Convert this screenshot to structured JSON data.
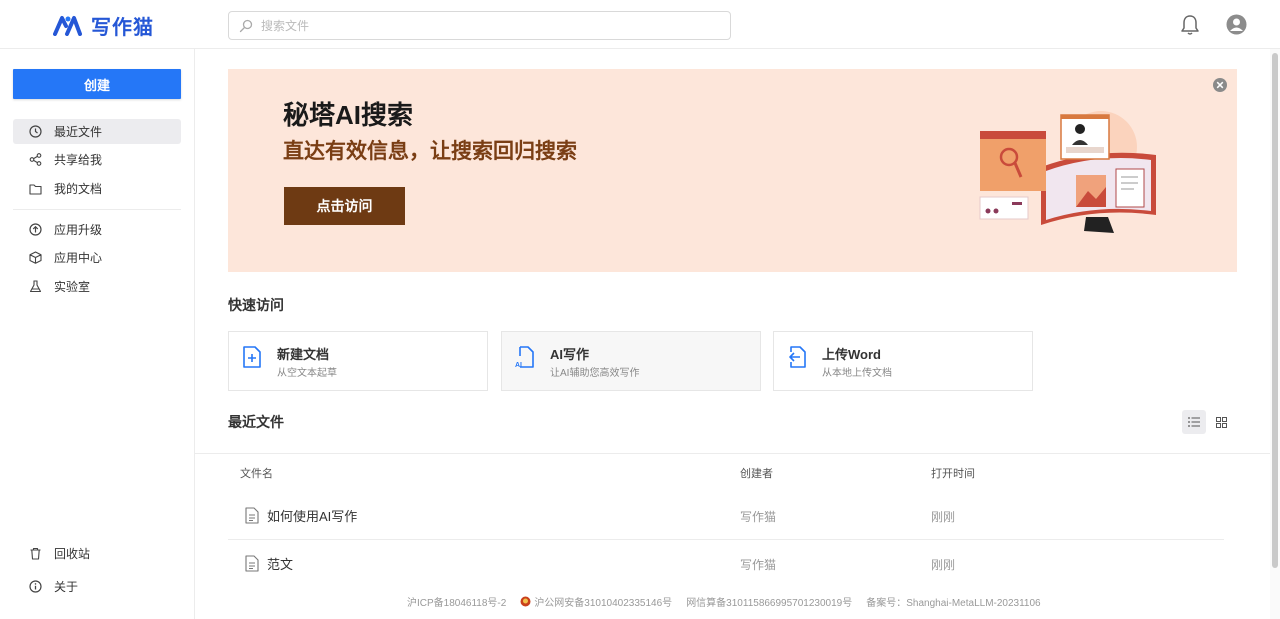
{
  "header": {
    "logo_text": "写作猫",
    "search_placeholder": "搜索文件"
  },
  "sidebar": {
    "create_label": "创建",
    "items": [
      {
        "label": "最近文件",
        "icon": "clock-icon",
        "active": true
      },
      {
        "label": "共享给我",
        "icon": "share-icon"
      },
      {
        "label": "我的文档",
        "icon": "folder-icon"
      },
      {
        "label": "应用升级",
        "icon": "upgrade-icon"
      },
      {
        "label": "应用中心",
        "icon": "cube-icon"
      },
      {
        "label": "实验室",
        "icon": "flask-icon"
      }
    ],
    "bottom_items": [
      {
        "label": "回收站",
        "icon": "trash-icon"
      },
      {
        "label": "关于",
        "icon": "info-icon"
      }
    ]
  },
  "banner": {
    "title": "秘塔AI搜索",
    "subtitle": "直达有效信息，让搜索回归搜索",
    "button_label": "点击访问"
  },
  "quick_access": {
    "title": "快速访问",
    "cards": [
      {
        "title": "新建文档",
        "desc": "从空文本起草",
        "icon": "new-doc-icon"
      },
      {
        "title": "AI写作",
        "desc": "让AI辅助您高效写作",
        "icon": "ai-doc-icon"
      },
      {
        "title": "上传Word",
        "desc": "从本地上传文档",
        "icon": "upload-doc-icon"
      }
    ]
  },
  "recent": {
    "title": "最近文件",
    "columns": [
      "文件名",
      "创建者",
      "打开时间"
    ],
    "rows": [
      {
        "name": "如何使用AI写作",
        "creator": "写作猫",
        "time": "刚刚"
      },
      {
        "name": "范文",
        "creator": "写作猫",
        "time": "刚刚"
      }
    ]
  },
  "footer": {
    "icp": "沪ICP备18046118号-2",
    "police": "沪公网安备31010402335146号",
    "algo": "网信算备310115866995701230019号",
    "record": "备案号：Shanghai-MetaLLM-20231106"
  },
  "colors": {
    "brand": "#2557d6",
    "create_button": "#2577f7",
    "banner_bg": "#fde6da",
    "banner_button": "#6e3a13"
  }
}
